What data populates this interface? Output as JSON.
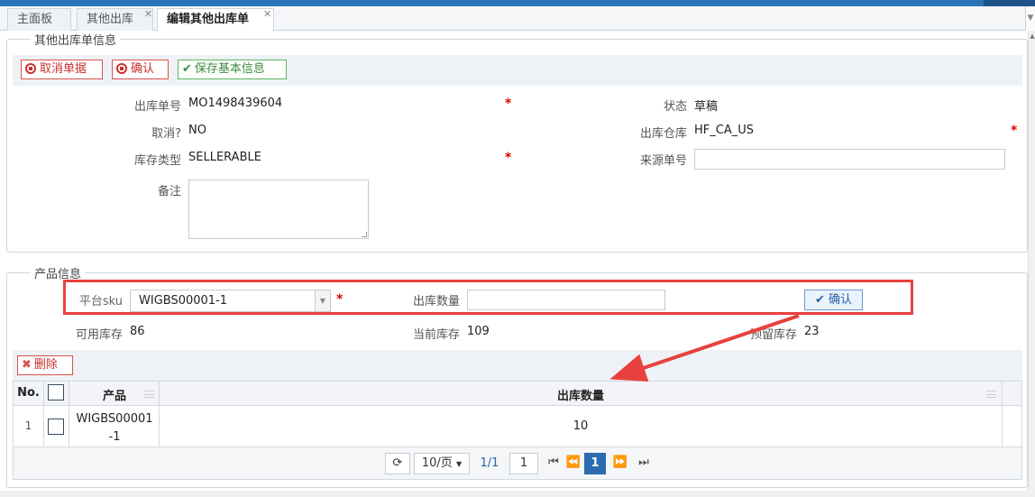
{
  "tabs": [
    {
      "label": "主面板"
    },
    {
      "label": "其他出库"
    },
    {
      "label": "编辑其他出库单"
    }
  ],
  "basic": {
    "legend": "其他出库单信息",
    "buttons": {
      "cancel_doc": "取消单据",
      "confirm": "确认",
      "save": "保存基本信息"
    },
    "fields": {
      "order_no_label": "出库单号",
      "order_no": "MO1498439604",
      "status_label": "状态",
      "status": "草稿",
      "cancelled_label": "取消?",
      "cancelled": "NO",
      "warehouse_label": "出库仓库",
      "warehouse": "HF_CA_US",
      "stock_type_label": "库存类型",
      "stock_type": "SELLERABLE",
      "source_no_label": "来源单号",
      "source_no": "",
      "remark_label": "备注",
      "remark": ""
    }
  },
  "product": {
    "legend": "产品信息",
    "sku_label": "平台sku",
    "sku_value": "WIGBS00001-1",
    "qty_label": "出库数量",
    "qty_value": "",
    "confirm": "确认",
    "available_label": "可用库存",
    "available": "86",
    "current_label": "当前库存",
    "current": "109",
    "reserved_label": "预留库存",
    "reserved": "23",
    "delete": "删除"
  },
  "grid": {
    "headers": {
      "no": "No.",
      "product": "产品",
      "qty": "出库数量"
    },
    "rows": [
      {
        "no": "1",
        "product_line1": "WIGBS00001",
        "product_line2": "-1",
        "qty": "10"
      }
    ],
    "pager": {
      "page_size": "10/页",
      "page_info": "1/1",
      "page_input": "1",
      "current_page": "1"
    }
  }
}
